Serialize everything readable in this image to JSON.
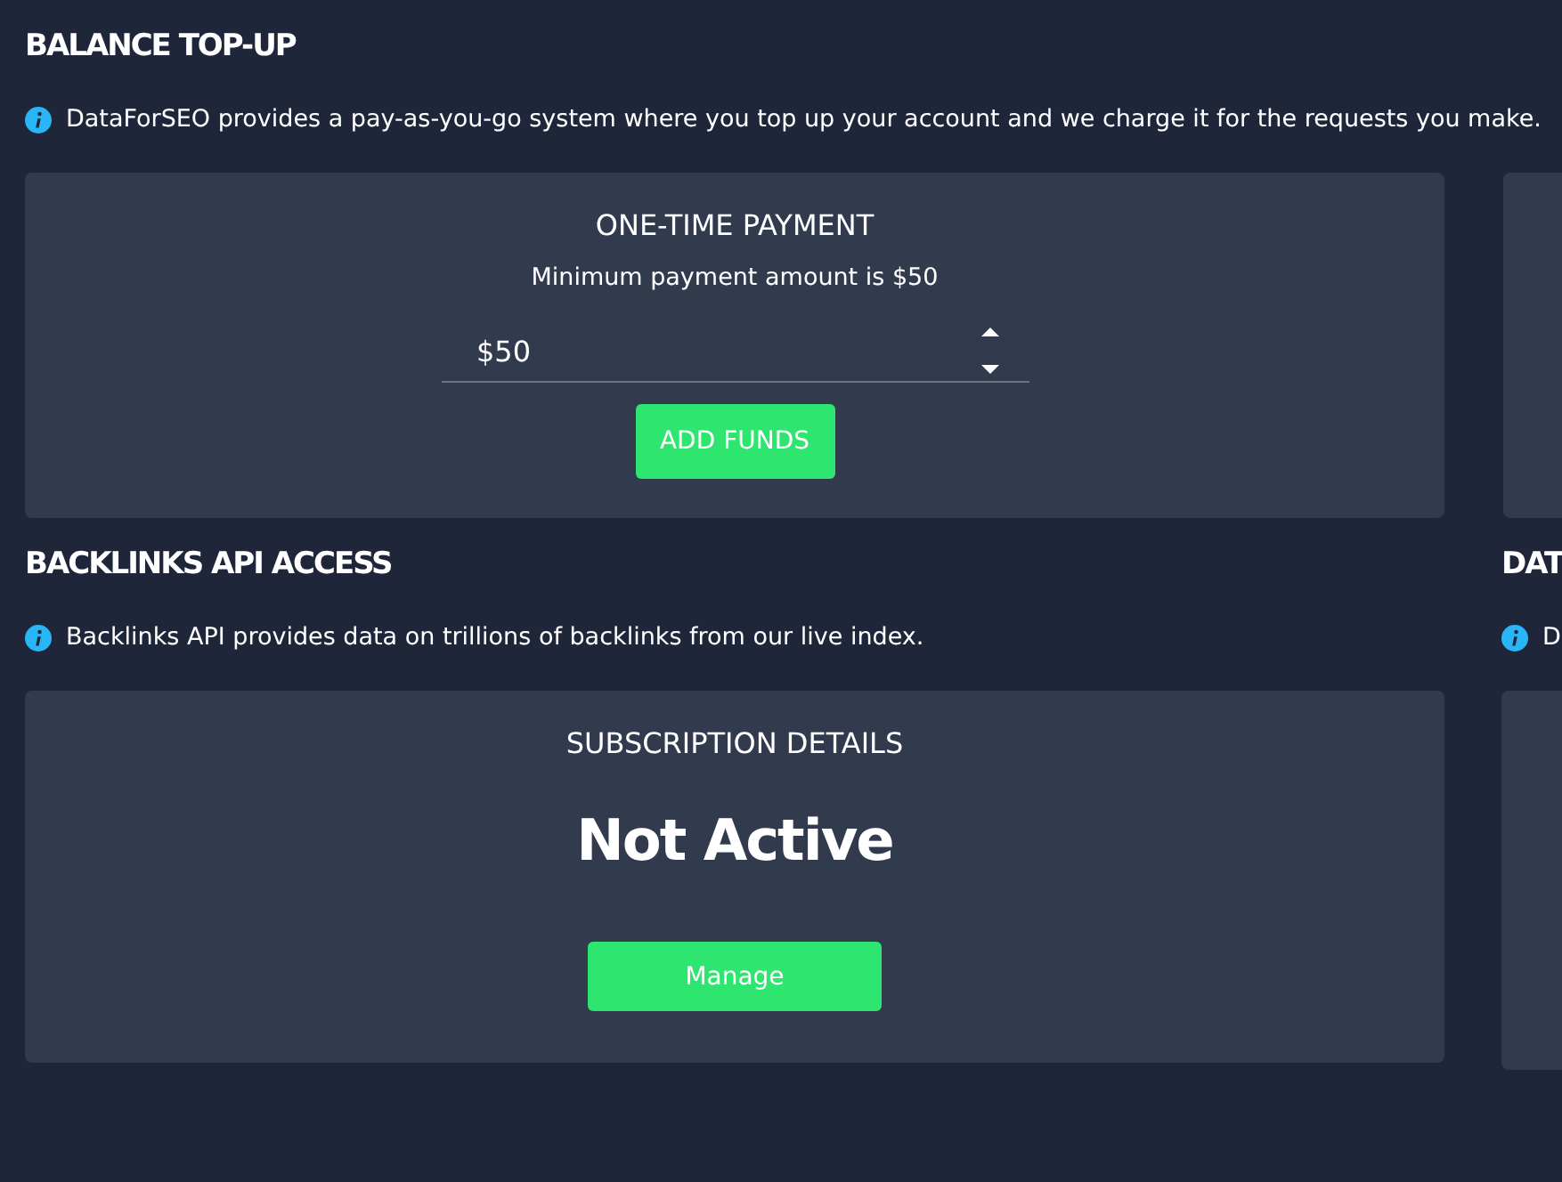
{
  "sections": [
    {
      "title": "BALANCE TOP-UP",
      "info": "DataForSEO provides a pay-as-you-go system where you top up your account and we charge it for the requests you make.",
      "cards": [
        {
          "kind": "payment",
          "title": "ONE-TIME PAYMENT",
          "note": "Minimum payment amount is $50",
          "amount": "$50",
          "button": "ADD FUNDS"
        },
        {
          "kind": "blank"
        }
      ]
    },
    {
      "title": "BACKLINKS API ACCESS",
      "info": "Backlinks API provides data on trillions of backlinks from our live index.",
      "cards": [
        {
          "kind": "subscription",
          "title": "SUBSCRIPTION DETAILS",
          "status": "Not Active",
          "button": "Manage"
        }
      ]
    },
    {
      "title": "DAT",
      "info": "D",
      "cards": [
        {
          "kind": "blank"
        }
      ]
    }
  ]
}
